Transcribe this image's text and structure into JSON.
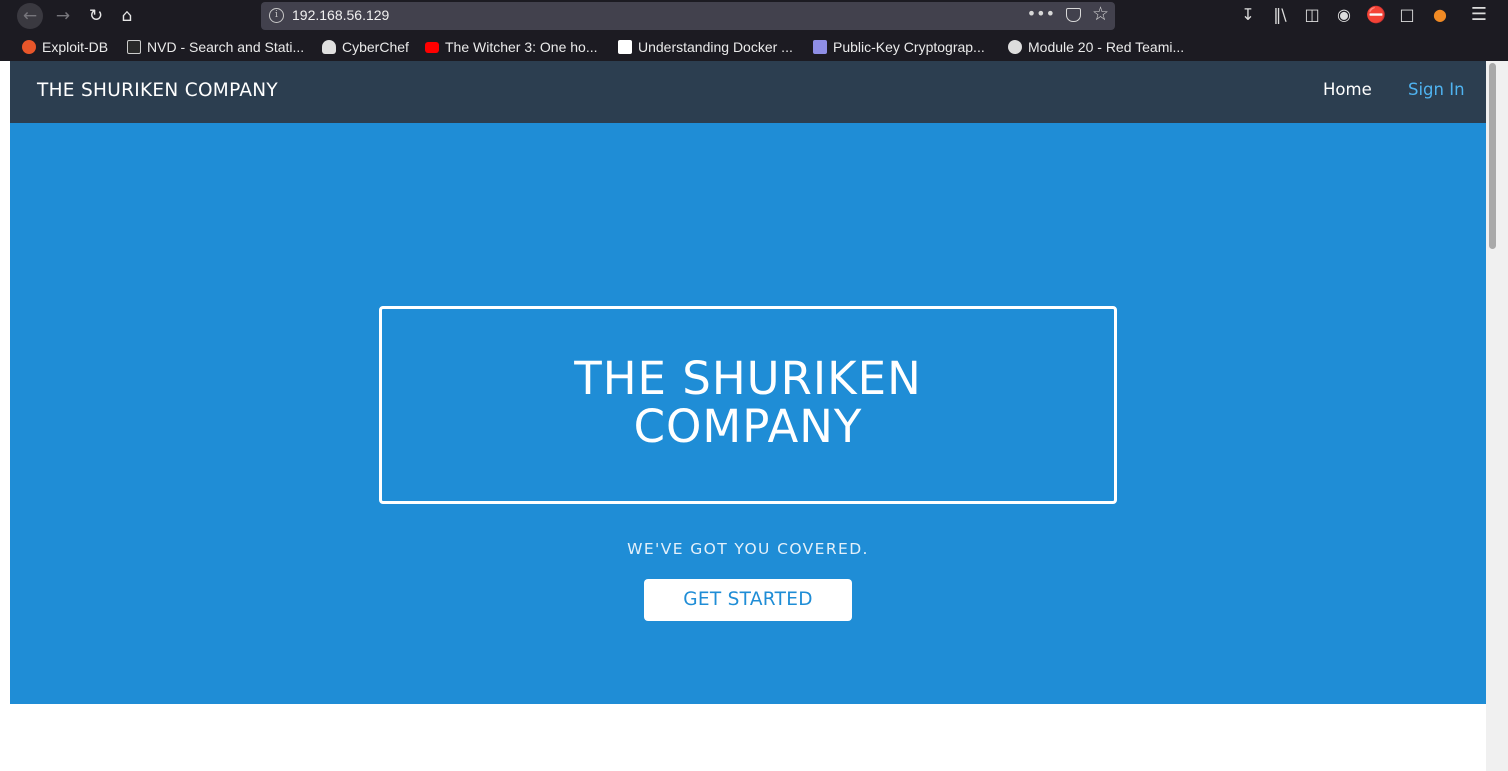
{
  "browser": {
    "url": "192.168.56.129",
    "bookmarks": [
      {
        "label": "Exploit-DB",
        "color": "#e8562a"
      },
      {
        "label": "NVD - Search and Stati...",
        "color": "#cccccc"
      },
      {
        "label": "CyberChef",
        "color": "#e0e0e0"
      },
      {
        "label": "The Witcher 3: One ho...",
        "color": "#ff0000"
      },
      {
        "label": "Understanding Docker ...",
        "color": "#ffffff"
      },
      {
        "label": "Public-Key Cryptograp...",
        "color": "#8e8ee6"
      },
      {
        "label": "Module 20 - Red Teami...",
        "color": "#dddddd"
      }
    ]
  },
  "navbar": {
    "brand": "THE SHURIKEN COMPANY",
    "links": [
      "Home",
      "Sign In"
    ]
  },
  "hero": {
    "title_line1": "THE SHURIKEN",
    "title_line2": "COMPANY",
    "tagline": "WE'VE GOT YOU COVERED.",
    "cta_label": "GET STARTED"
  },
  "colors": {
    "navbar_bg": "#2c3e50",
    "hero_bg": "#1f8dd6",
    "link_accent": "#4fb3f0"
  }
}
